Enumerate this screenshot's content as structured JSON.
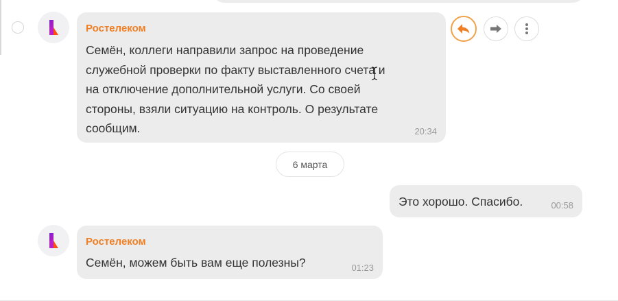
{
  "messages": [
    {
      "sender": "Ростелеком",
      "lines": [
        "Семён, коллеги направили запрос на проведение",
        "служебной проверки по факту выставленного счета и",
        "на отключение дополнительной услуги. Со своей",
        "стороны, взяли ситуацию на контроль. О результате",
        "сообщим."
      ],
      "time": "20:34"
    },
    {
      "text": "Это хорошо. Спасибо.",
      "time": "00:58"
    },
    {
      "sender": "Ростелеком",
      "text": "Семён, можем быть вам еще полезны?",
      "time": "01:23"
    }
  ],
  "date_separator": "6 марта",
  "icons": {
    "avatar": "rostelecom-logo-icon",
    "reply": "reply-arrow-icon",
    "forward": "forward-arrow-icon",
    "more": "more-vertical-icon"
  },
  "colors": {
    "accent": "#ee7f24",
    "bubble": "#ececec",
    "logo_purple": "#7a1fd6",
    "logo_orange": "#ff4f12"
  }
}
